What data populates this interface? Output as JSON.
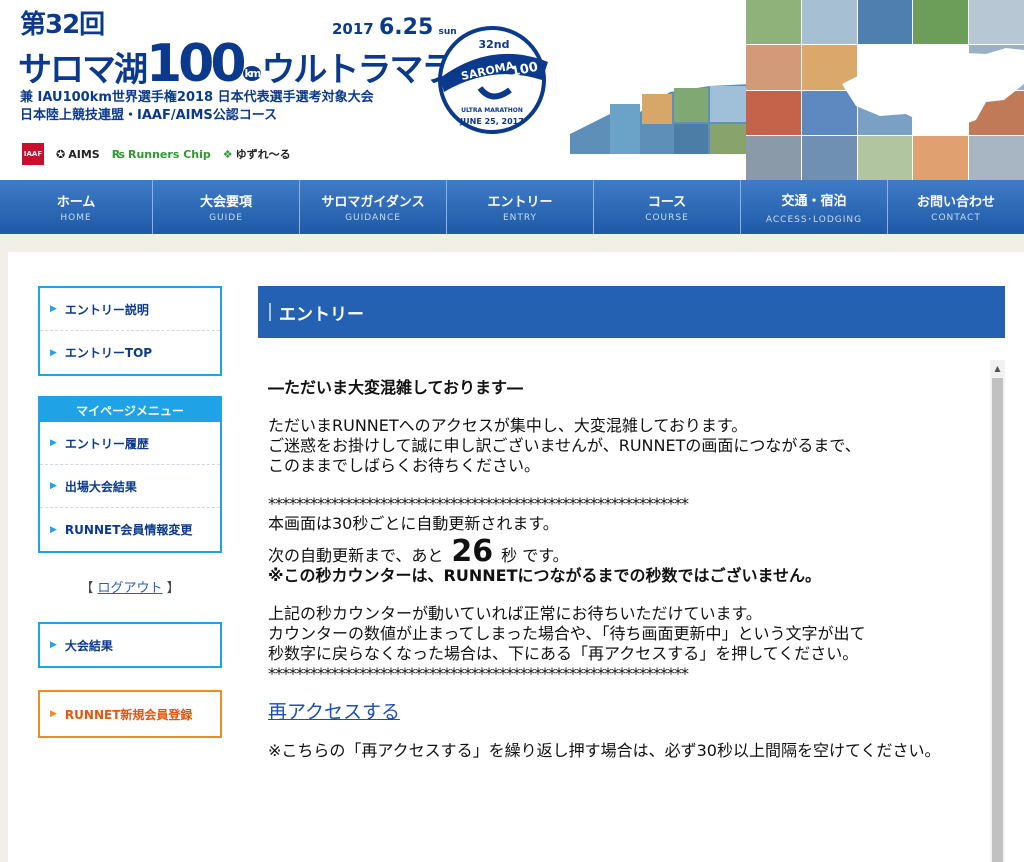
{
  "header": {
    "edition": "第32回",
    "date_year": "2017",
    "date_md": "6.25",
    "date_day": "sun",
    "title_pre": "サロマ湖",
    "title_num": "100",
    "title_km": "km",
    "title_post": "ウルトラマラソン",
    "subtitle1": "兼 IAU100km世界選手権2018 日本代表選手選考対象大会",
    "subtitle2": "日本陸上競技連盟・IAAF/AIMS公認コース",
    "sponsors": [
      "IAAF",
      "AIMS",
      "Runners Chip",
      "ゆずれ～る"
    ],
    "emblem_top": "32nd",
    "emblem_name": "SAROMA",
    "emblem_num": "100",
    "emblem_sub": "ULTRA MARATHON",
    "emblem_date": "JUNE 25, 2017"
  },
  "nav": [
    {
      "jp": "ホーム",
      "en": "HOME"
    },
    {
      "jp": "大会要項",
      "en": "GUIDE"
    },
    {
      "jp": "サロマガイダンス",
      "en": "GUIDANCE"
    },
    {
      "jp": "エントリー",
      "en": "ENTRY"
    },
    {
      "jp": "コース",
      "en": "COURSE"
    },
    {
      "jp": "交通・宿泊",
      "en": "ACCESS･LODGING"
    },
    {
      "jp": "お問い合わせ",
      "en": "CONTACT"
    }
  ],
  "sidebar": {
    "box1": [
      "エントリー説明",
      "エントリーTOP"
    ],
    "mypage_title": "マイページメニュー",
    "box2": [
      "エントリー履歴",
      "出場大会結果",
      "RUNNET会員情報変更"
    ],
    "logout_open": "【",
    "logout": "ログアウト",
    "logout_close": "】",
    "box4": [
      "大会結果"
    ],
    "box5": [
      "RUNNET新規会員登録"
    ]
  },
  "main": {
    "heading": "エントリー",
    "busy_title": "―ただいま大変混雑しております―",
    "msg1": "ただいまRUNNETへのアクセスが集中し、大変混雑しております。",
    "msg2": "ご迷惑をお掛けして誠に申し訳ございませんが、RUNNETの画面につながるまで、",
    "msg3": "このままでしばらくお待ちください。",
    "stars": "************************************************************",
    "auto_refresh": "本画面は30秒ごとに自動更新されます。",
    "next_pre": "次の自動更新まで、あと",
    "counter": "26",
    "next_post": "秒 です。",
    "note_bold": "※この秒カウンターは、RUNNETにつながるまでの秒数ではございません。",
    "info1": "上記の秒カウンターが動いていれば正常にお待ちいただけています。",
    "info2": "カウンターの数値が止まってしまった場合や、「待ち画面更新中」という文字が出て",
    "info3": "秒数字に戻らなくなった場合は、下にある「再アクセスする」を押してください。",
    "reaccess": "再アクセスする",
    "final": "※こちらの「再アクセスする」を繰り返し押す場合は、必ず30秒以上間隔を空けてください。"
  },
  "colors": {
    "brand_blue": "#0b3a8c",
    "nav_blue": "#2461b3",
    "side_cyan": "#1fa3e6",
    "side_orange": "#f08b1f"
  }
}
